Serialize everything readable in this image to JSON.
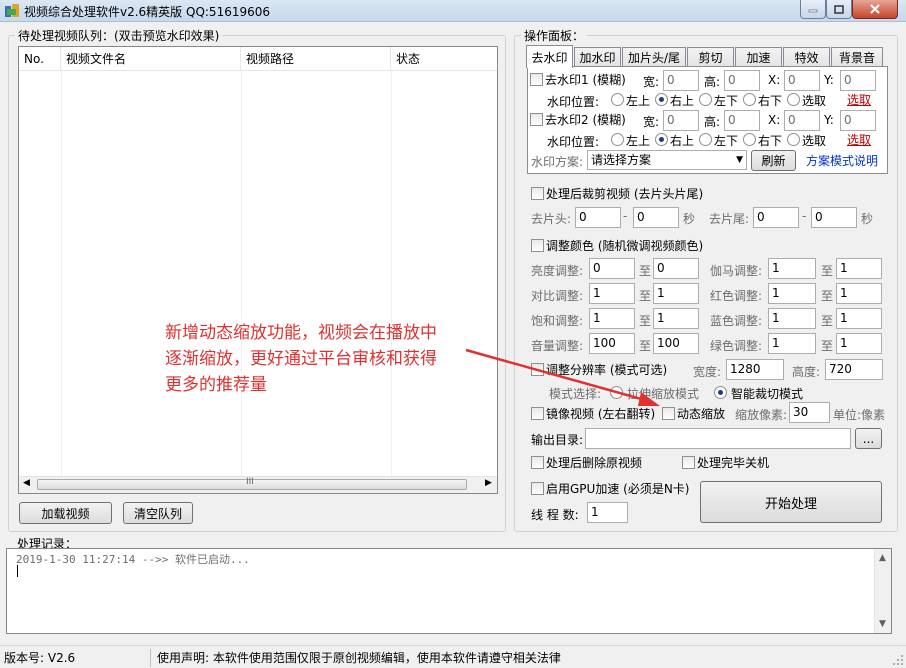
{
  "window": {
    "title": "视频综合处理软件v2.6精英版  QQ:51619606"
  },
  "queue": {
    "title": "待处理视频队列：(双击预览水印效果)",
    "columns": [
      "No.",
      "视频文件名",
      "视频路径",
      "状态"
    ],
    "load_button": "加载视频",
    "clear_button": "清空队列"
  },
  "panel": {
    "title": "操作面板：",
    "tabs": [
      "去水印",
      "加水印",
      "加片头/尾",
      "剪切",
      "加速",
      "特效",
      "背景音"
    ],
    "active_tab": 0,
    "wm1": {
      "label": "去水印1 (模糊)",
      "w_label": "宽:",
      "w": "0",
      "h_label": "高:",
      "h": "0",
      "x_label": "X:",
      "x": "0",
      "y_label": "Y:",
      "y": "0",
      "pos_label": "水印位置:",
      "positions": [
        "左上",
        "右上",
        "左下",
        "右下",
        "选取"
      ],
      "selected": 1,
      "pick": "选取"
    },
    "wm2": {
      "label": "去水印2 (模糊)",
      "w_label": "宽:",
      "w": "0",
      "h_label": "高:",
      "h": "0",
      "x_label": "X:",
      "x": "0",
      "y_label": "Y:",
      "y": "0",
      "pos_label": "水印位置:",
      "positions": [
        "左上",
        "右上",
        "左下",
        "右下",
        "选取"
      ],
      "selected": 1,
      "pick": "选取"
    },
    "scheme_label": "水印方案:",
    "scheme_value": "请选择方案",
    "refresh_button": "刷新",
    "scheme_help": "方案模式说明"
  },
  "trim": {
    "label": "处理后裁剪视频 (去片头片尾)",
    "head_label": "去片头:",
    "head_a": "0",
    "head_b": "0",
    "tail_label": "去片尾:",
    "tail_a": "0",
    "tail_b": "0",
    "dash": "-",
    "unit": "秒"
  },
  "color": {
    "label": "调整颜色 (随机微调视频颜色)",
    "to": "至",
    "rows": [
      {
        "l1": "亮度调整:",
        "a1": "0",
        "b1": "0",
        "l2": "伽马调整:",
        "a2": "1",
        "b2": "1"
      },
      {
        "l1": "对比调整:",
        "a1": "1",
        "b1": "1",
        "l2": "红色调整:",
        "a2": "1",
        "b2": "1"
      },
      {
        "l1": "饱和调整:",
        "a1": "1",
        "b1": "1",
        "l2": "蓝色调整:",
        "a2": "1",
        "b2": "1"
      },
      {
        "l1": "音量调整:",
        "a1": "100",
        "b1": "100",
        "l2": "绿色调整:",
        "a2": "1",
        "b2": "1"
      }
    ]
  },
  "resolution": {
    "label": "调整分辨率 (模式可选)",
    "w_label": "宽度:",
    "w": "1280",
    "h_label": "高度:",
    "h": "720",
    "mode_label": "模式选择:",
    "mode_stretch": "拉伸缩放模式",
    "mode_smart": "智能裁切模式"
  },
  "mirror": {
    "label": "镜像视频 (左右翻转)"
  },
  "zoom": {
    "label": "动态缩放",
    "pixels_label": "缩放像素:",
    "pixels": "30",
    "unit": "单位:像素"
  },
  "output": {
    "label": "输出目录:",
    "value": "",
    "browse": "..."
  },
  "delete_after": "处理后删除原视频",
  "shutdown_after": "处理完毕关机",
  "gpu": "启用GPU加速 (必须是N卡)",
  "threads": {
    "label": "线 程 数:",
    "value": "1"
  },
  "start_button": "开始处理",
  "annotation": {
    "lines": [
      "新增动态缩放功能，视频会在播放中",
      "逐渐缩放，更好通过平台审核和获得",
      "更多的推荐量"
    ]
  },
  "log": {
    "title": "处理记录：",
    "entry": "2019-1-30 11:27:14 -->> 软件已启动..."
  },
  "status": {
    "version": "版本号: V2.6",
    "notice": "使用声明: 本软件使用范围仅限于原创视频编辑，使用本软件请遵守相关法律"
  },
  "colors": {
    "annotation": "#e03030",
    "link_red": "#c00000",
    "link_blue": "#0033cc"
  }
}
